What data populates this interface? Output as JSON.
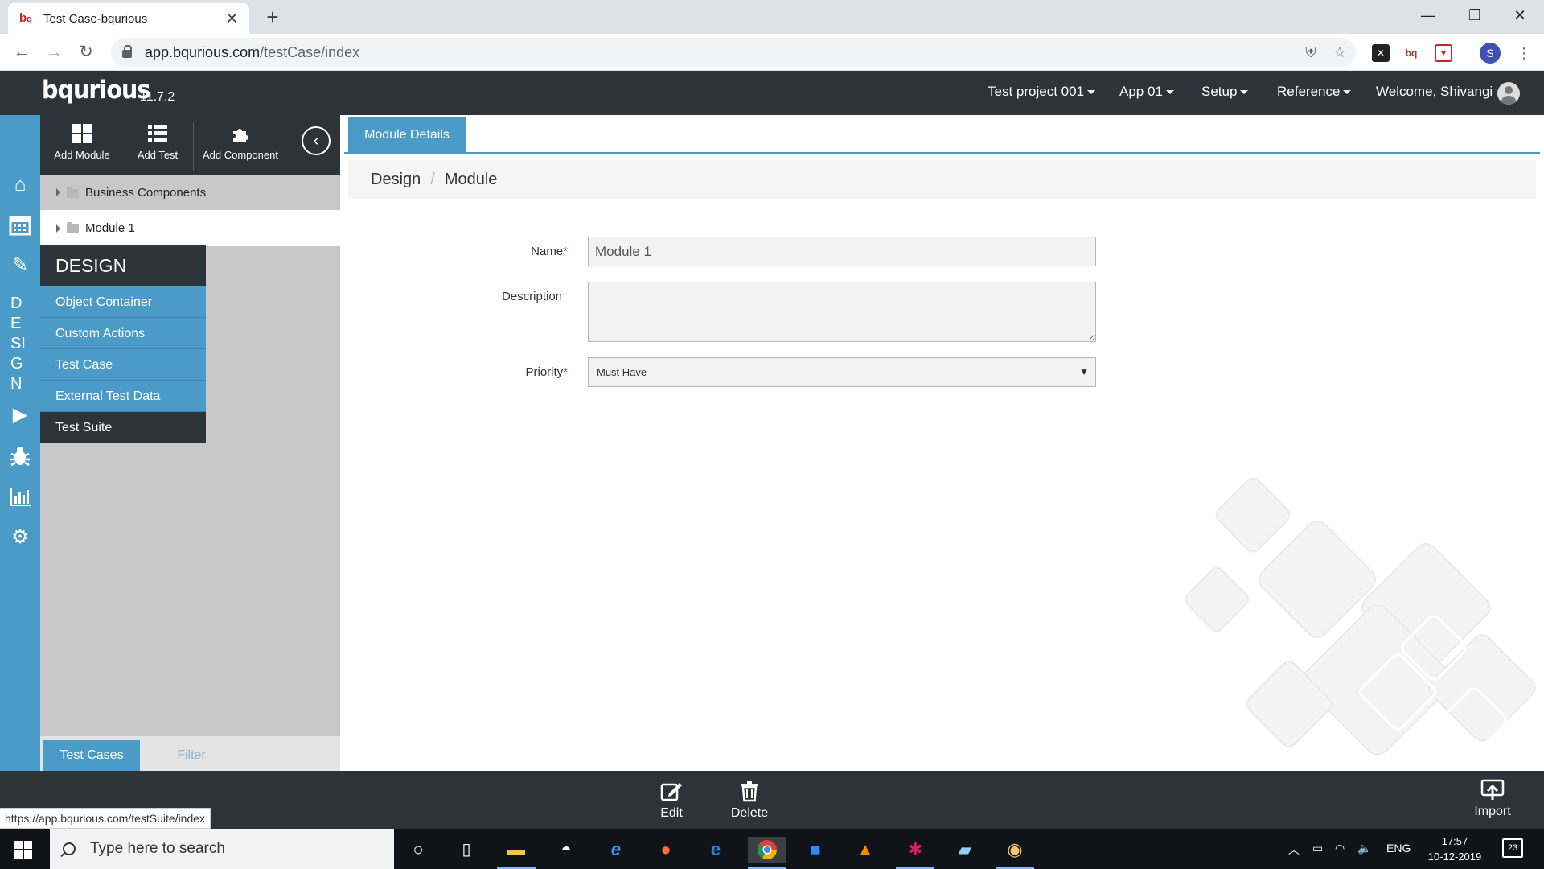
{
  "browser": {
    "tab_title": "Test Case-bqurious",
    "url_host": "app.bqurious.com",
    "url_path": "/testCase/index",
    "profile_initial": "S",
    "status_url": "https://app.bqurious.com/testSuite/index"
  },
  "header": {
    "logo": "bqurious",
    "version": "11.7.2",
    "menus": [
      {
        "label": "Test project 001"
      },
      {
        "label": "App 01"
      },
      {
        "label": "Setup"
      },
      {
        "label": "Reference"
      }
    ],
    "welcome": "Welcome, Shivangi"
  },
  "rail": {
    "vertical_label": [
      "D",
      "E",
      "SI",
      "G",
      "N"
    ],
    "icons": [
      "home-icon",
      "calendar-icon",
      "pencil-icon",
      "play-icon",
      "bug-icon",
      "bar-chart-icon",
      "gears-icon"
    ]
  },
  "sidebar": {
    "tools": [
      {
        "label": "Add Module",
        "icon": "grid-icon"
      },
      {
        "label": "Add Test",
        "icon": "list-icon"
      },
      {
        "label": "Add Component",
        "icon": "puzzle-icon"
      }
    ],
    "tree": [
      {
        "label": "Business Components"
      },
      {
        "label": "Module 1"
      }
    ],
    "design_menu": {
      "title": "DESIGN",
      "items": [
        {
          "label": "Object Container"
        },
        {
          "label": "Custom Actions"
        },
        {
          "label": "Test Case"
        },
        {
          "label": "External Test Data"
        },
        {
          "label": "Test Suite"
        }
      ]
    },
    "bottom_tabs": [
      {
        "label": "Test Cases"
      },
      {
        "label": "Filter"
      }
    ]
  },
  "main": {
    "tab": "Module Details",
    "breadcrumb": [
      "Design",
      "Module"
    ],
    "form": {
      "name_label": "Name",
      "name_value": "Module 1",
      "description_label": "Description",
      "description_value": "",
      "priority_label": "Priority",
      "priority_value": "Must Have",
      "required_mark": "*"
    }
  },
  "bottombar": {
    "edit": "Edit",
    "delete": "Delete",
    "import": "Import"
  },
  "taskbar": {
    "search_placeholder": "Type here to search",
    "language": "ENG",
    "time": "17:57",
    "date": "10-12-2019",
    "notifications": "23"
  },
  "colors": {
    "accent": "#4a9bc7",
    "dark": "#2d3439",
    "sidebar_bg": "#c8c8c8"
  }
}
